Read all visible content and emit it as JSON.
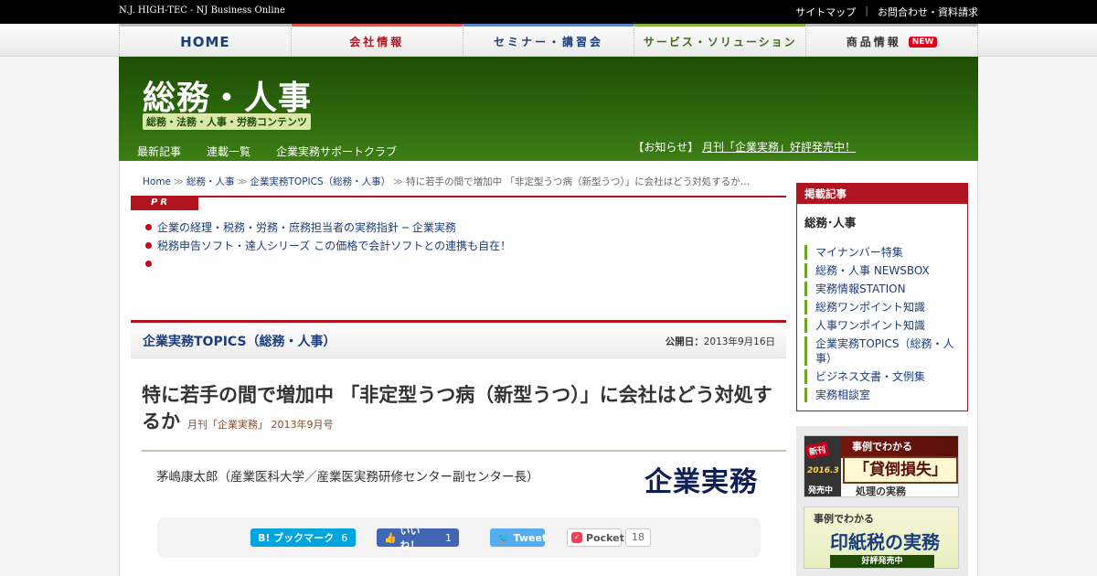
{
  "topbar": {
    "brand": "N.J. HIGH-TEC - NJ Business Online",
    "links": [
      "サイトマップ",
      "お問合わせ・資料請求"
    ]
  },
  "nav": {
    "home": "HOME",
    "company": "会社情報",
    "seminar": "セミナー・講習会",
    "service": "サービス・ソリューション",
    "product": "商品情報",
    "new_badge": "NEW"
  },
  "header": {
    "title": "総務・人事",
    "subtitle": "総務・法務・人事・労務コンテンツ",
    "subnav": [
      "最新記事",
      "連載一覧",
      "企業実務サポートクラブ"
    ],
    "notice_prefix": "【お知らせ】",
    "notice_link": "月刊「企業実務」好評発売中！"
  },
  "breadcrumb": {
    "items": [
      "Home",
      "総務・人事",
      "企業実務TOPICS（総務・人事）"
    ],
    "current": "特に若手の間で増加中 「非定型うつ病（新型うつ）」に会社はどう対処するか…",
    "separator": "≫"
  },
  "pr": {
    "label": "PR",
    "items": [
      "企業の経理・税務・労務・庶務担当者の実務指針 ─ 企業実務",
      "税務申告ソフト・達人シリーズ この価格で会計ソフトとの連携も自在！",
      ""
    ]
  },
  "section": {
    "title": "企業実務TOPICS（総務・人事）",
    "date_label": "公開日：",
    "date": "2013年9月16日"
  },
  "article": {
    "title": "特に若手の間で増加中 「非定型うつ病（新型うつ）」に会社はどう対処するか",
    "source": "月刊「企業実務」 2013年9月号",
    "author": "茅嶋康太郎（産業医科大学／産業医実務研修センター副センター長）",
    "magazine_logo": "企業実務"
  },
  "share": {
    "hatena_label": "B! ブックマーク",
    "hatena_count": "6",
    "fb_label": "いいね！",
    "fb_count": "1",
    "tweet_label": "Tweet",
    "pocket_label": "Pocket",
    "pocket_count": "18"
  },
  "sidebar": {
    "heading": "掲載記事",
    "category": "総務･人事",
    "items": [
      "マイナンバー特集",
      "総務・人事 NEWSBOX",
      "実務情報STATION",
      "総務ワンポイント知識",
      "人事ワンポイント知識",
      "企業実務TOPICS（総務・人事）",
      "ビジネス文書・文例集",
      "実務相談室"
    ]
  },
  "banners": {
    "b1_top": "事例でわかる",
    "b1_main": "「貸倒損失」",
    "b1_bottom": "処理の実務",
    "b1_new": "新刊",
    "b1_year": "2016.3",
    "b1_sale": "発売中",
    "b2_top": "事例でわかる",
    "b2_main": "印紙税の実務",
    "b2_bottom": "好評発売中"
  },
  "colors": {
    "brand_red": "#b0141e",
    "header_green": "#2e6a0c",
    "link_blue": "#1a3d7c"
  }
}
